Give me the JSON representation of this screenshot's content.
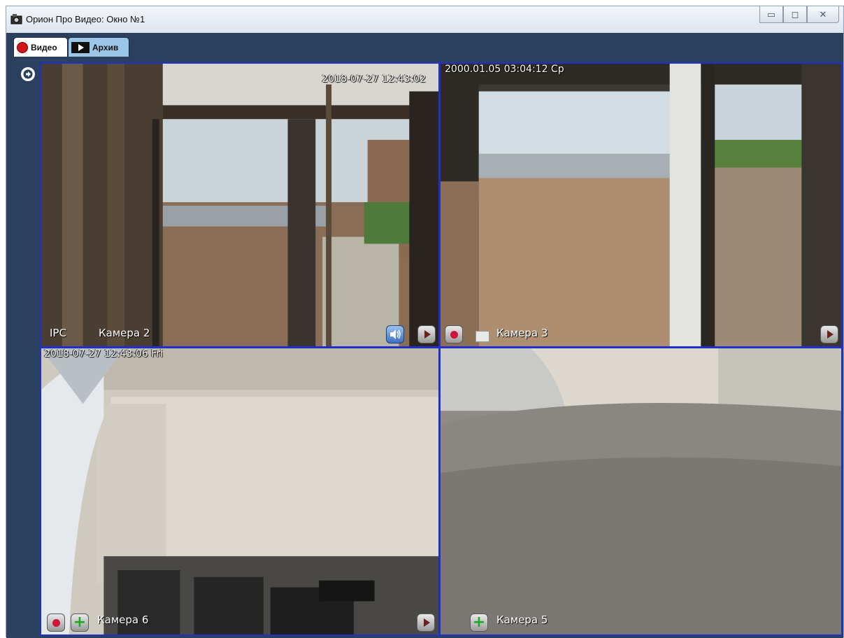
{
  "window": {
    "title": "Орион Про Видео: Окно №1",
    "controls": {
      "minimize": "▭",
      "maximize": "◻",
      "close": "✕"
    }
  },
  "tabs": [
    {
      "label": "Видео",
      "icon": "record-dot-icon",
      "active": true
    },
    {
      "label": "Архив",
      "icon": "film-icon",
      "active": false
    }
  ],
  "cameras": [
    {
      "id": "cell1",
      "label": "Камера 2",
      "prefix": "IPC",
      "timestamp": "2018-07-27 12:43:02",
      "controls": [
        "volume",
        "play"
      ]
    },
    {
      "id": "cell2",
      "label": "Камера 3",
      "timestamp": "2000.01.05 03:04:12 Ср",
      "controls": [
        "record",
        "snapshot",
        "play"
      ]
    },
    {
      "id": "cell3",
      "label": "Камера 6",
      "timestamp": "2018-07-27 12:43:06 Fri",
      "controls": [
        "record",
        "add",
        "play"
      ]
    },
    {
      "id": "cell4",
      "label": "Камера 5",
      "timestamp": "",
      "controls": [
        "add"
      ]
    }
  ],
  "colors": {
    "frame_bg": "#2b3f5e",
    "cell_border": "#2030c8",
    "record": "#d21717",
    "archive_tab": "#9cc6e8"
  }
}
